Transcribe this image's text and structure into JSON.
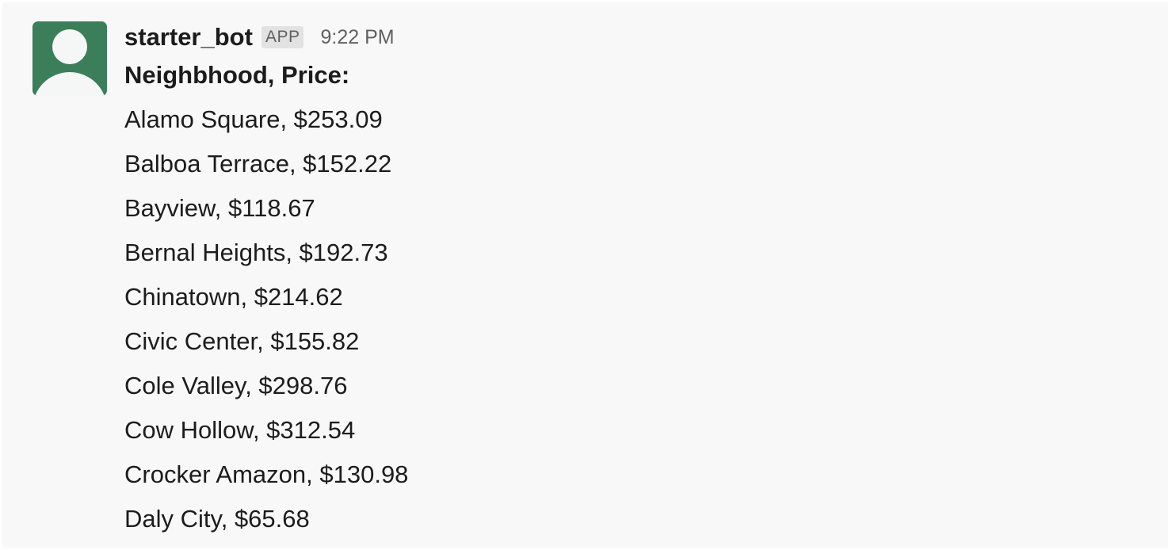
{
  "message": {
    "sender": "starter_bot",
    "badge": "APP",
    "time": "9:22 PM",
    "avatar_icon": "user-silhouette-icon",
    "avatar_color": "#3a7f59",
    "heading": "Neighbhood, Price:",
    "lines": [
      "Alamo Square, $253.09",
      "Balboa Terrace, $152.22",
      "Bayview, $118.67",
      "Bernal Heights, $192.73",
      "Chinatown, $214.62",
      "Civic Center, $155.82",
      "Cole Valley, $298.76",
      "Cow Hollow, $312.54",
      "Crocker Amazon, $130.98",
      "Daly City, $65.68"
    ]
  }
}
